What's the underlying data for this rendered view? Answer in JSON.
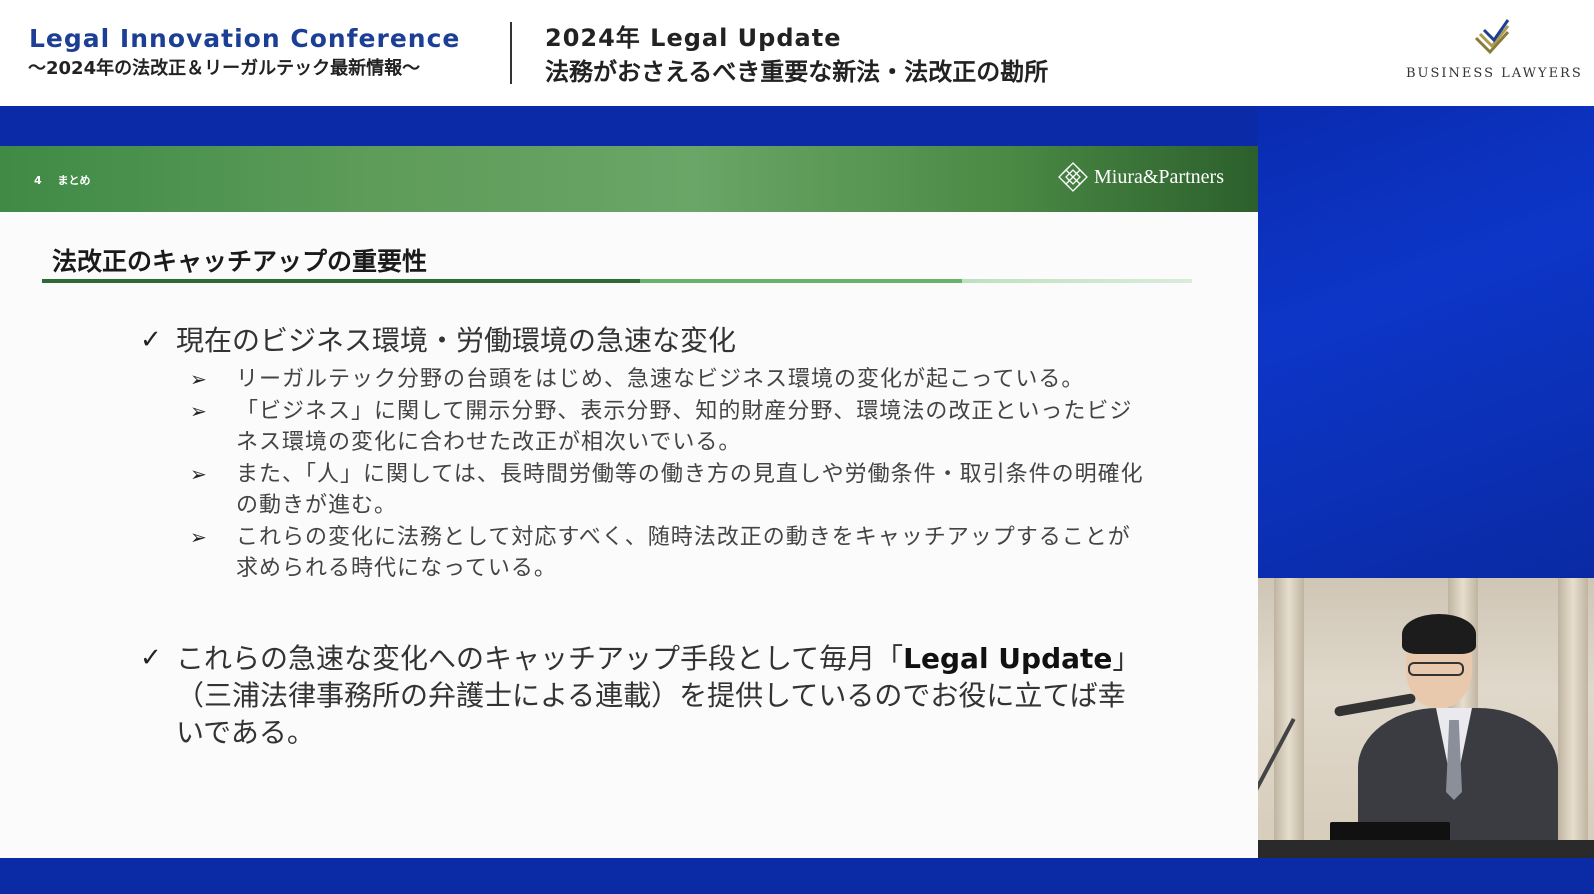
{
  "header": {
    "conference_title": "Legal Innovation Conference",
    "conference_subtitle": "〜2024年の法改正＆リーガルテック最新情報〜",
    "session_title": "2024年 Legal Update",
    "session_subtitle": "法務がおさえるべき重要な新法・法改正の勘所",
    "brand": "BUSINESS LAWYERS",
    "brand_icon": "stacked-lines-logo-icon"
  },
  "slide": {
    "section_number": "4",
    "section_label": "まとめ",
    "firm_name": "Miura&Partners",
    "firm_icon": "lattice-diamond-icon",
    "heading": "法改正のキャッチアップの重要性",
    "points": [
      {
        "text": "現在のビジネス環境・労働環境の急速な変化",
        "subpoints": [
          "リーガルテック分野の台頭をはじめ、急速なビジネス環境の変化が起こっている。",
          "「ビジネス」に関して開示分野、表示分野、知的財産分野、環境法の改正といったビジネス環境の変化に合わせた改正が相次いでいる。",
          "また、「人」に関しては、長時間労働等の働き方の見直しや労働条件・取引条件の明確化の動きが進む。",
          "これらの変化に法務として対応すべく、随時法改正の動きをキャッチアップすることが求められる時代になっている。"
        ]
      },
      {
        "text_before": "これらの急速な変化へのキャッチアップ手段として毎月「",
        "text_bold": "Legal Update",
        "text_after": "」（三浦法律事務所の弁護士による連載）を提供しているのでお役に立てば幸いである。"
      }
    ],
    "check_glyph": "✓",
    "arrow_glyph": "➢"
  },
  "colors": {
    "brand_blue": "#1c3f95",
    "background_blue": "#0b2aa8",
    "slide_header_green": "#5e9c5a"
  }
}
